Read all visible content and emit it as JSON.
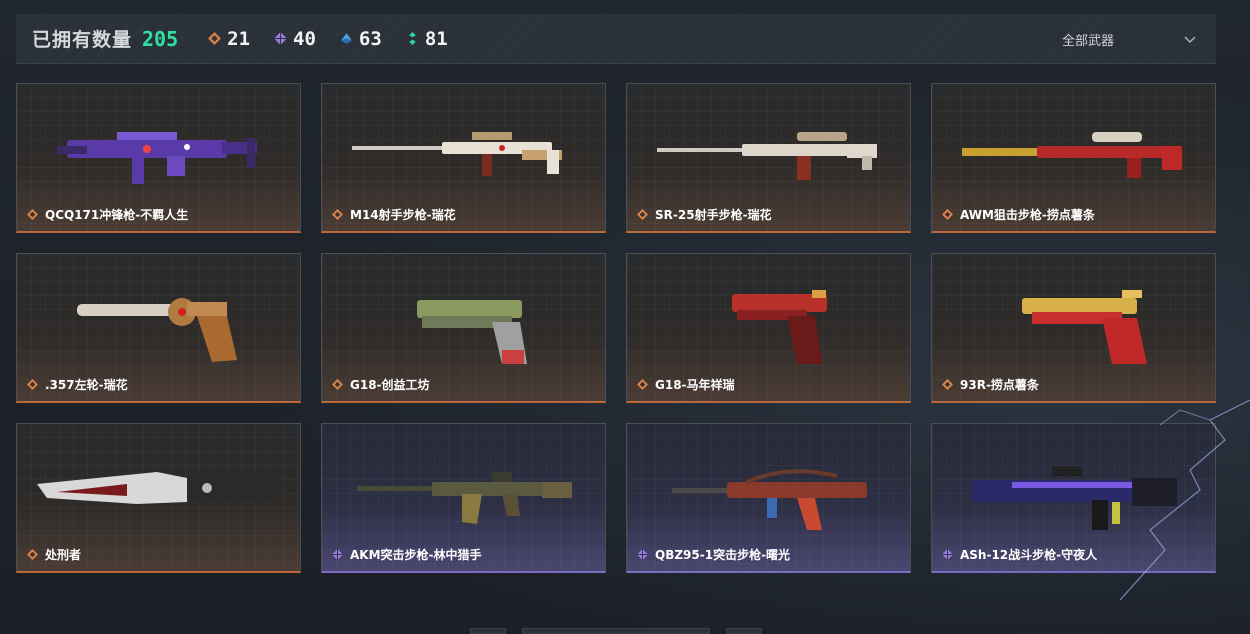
{
  "header": {
    "owned_label": "已拥有数量",
    "owned_count": "205",
    "rarities": [
      {
        "icon": "orange-gem-icon",
        "color": "#d8834a",
        "count": "21"
      },
      {
        "icon": "purple-gem-icon",
        "color": "#9b7be0",
        "count": "40"
      },
      {
        "icon": "blue-gem-icon",
        "color": "#4ea0e8",
        "count": "63"
      },
      {
        "icon": "green-gem-icon",
        "color": "#2fd6a0",
        "count": "81"
      }
    ],
    "filter_label": "全部武器"
  },
  "weapons": [
    {
      "name": "QCQ171冲锋枪-不羁人生",
      "rarity": "orange",
      "art": "smg-purple"
    },
    {
      "name": "M14射手步枪-瑞花",
      "rarity": "orange",
      "art": "rifle-white"
    },
    {
      "name": "SR-25射手步枪-瑞花",
      "rarity": "orange",
      "art": "rifle-white2"
    },
    {
      "name": "AWM狙击步枪-捞点薯条",
      "rarity": "orange",
      "art": "sniper-red"
    },
    {
      "name": ".357左轮-瑞花",
      "rarity": "orange",
      "art": "revolver"
    },
    {
      "name": "G18-创益工坊",
      "rarity": "orange",
      "art": "pistol-green"
    },
    {
      "name": "G18-马年祥瑞",
      "rarity": "orange",
      "art": "pistol-red"
    },
    {
      "name": "93R-捞点薯条",
      "rarity": "orange",
      "art": "pistol-gold"
    },
    {
      "name": "处刑者",
      "rarity": "orange",
      "art": "knife"
    },
    {
      "name": "AKM突击步枪-林中猎手",
      "rarity": "purple",
      "art": "ak-camo"
    },
    {
      "name": "QBZ95-1突击步枪-曙光",
      "rarity": "purple",
      "art": "bullpup"
    },
    {
      "name": "ASh-12战斗步枪-守夜人",
      "rarity": "purple",
      "art": "ash-blue"
    }
  ],
  "colors": {
    "accent_green": "#2fe0a0",
    "orange": "#d8834a",
    "purple": "#9b7be0"
  }
}
